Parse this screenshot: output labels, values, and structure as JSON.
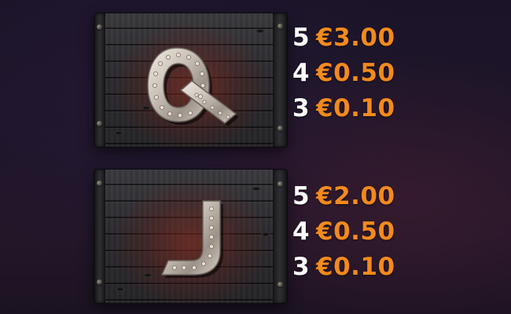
{
  "theme": {
    "payout_color": "#f38a1c",
    "count_color": "#ffffff",
    "background_color": "#1e1529",
    "crate_color": "#2f2e32"
  },
  "symbols": [
    {
      "symbol": "Q",
      "icon": "letter-q-crate-icon",
      "payouts": [
        {
          "count": "5",
          "amount": "€3.00"
        },
        {
          "count": "4",
          "amount": "€0.50"
        },
        {
          "count": "3",
          "amount": "€0.10"
        }
      ]
    },
    {
      "symbol": "J",
      "icon": "letter-j-crate-icon",
      "payouts": [
        {
          "count": "5",
          "amount": "€2.00"
        },
        {
          "count": "4",
          "amount": "€0.50"
        },
        {
          "count": "3",
          "amount": "€0.10"
        }
      ]
    }
  ]
}
